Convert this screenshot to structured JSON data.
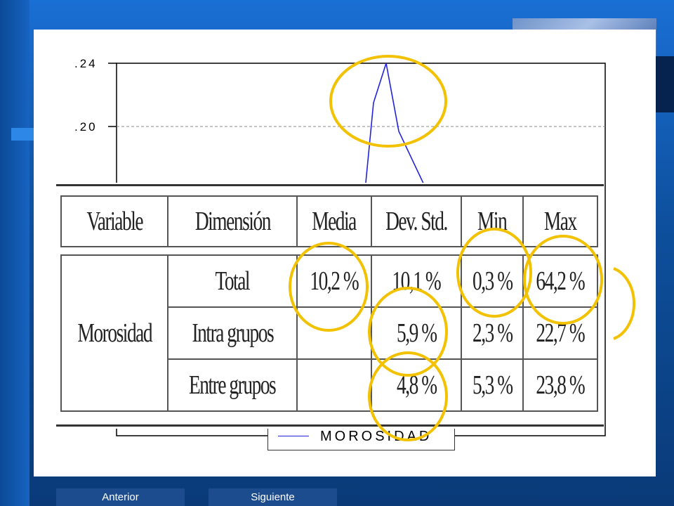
{
  "chart": {
    "y_ticks": [
      ".24",
      ".20"
    ],
    "legend_label": "MOROSIDAD"
  },
  "chart_data": {
    "type": "line",
    "series": [
      {
        "name": "MOROSIDAD",
        "values": [
          0.16,
          0.215,
          0.24,
          0.197,
          0.15
        ]
      }
    ],
    "ylim": [
      0.14,
      0.24
    ],
    "yticks": [
      0.2,
      0.24
    ]
  },
  "table": {
    "headers": [
      "Variable",
      "Dimensión",
      "Media",
      "Dev. Std.",
      "Min",
      "Max"
    ],
    "group_label": "Morosidad",
    "rows": [
      {
        "dimension": "Total",
        "media": "10,2 %",
        "dev": "10,1 %",
        "min": "0,3 %",
        "max": "64,2 %"
      },
      {
        "dimension": "Intra grupos",
        "media": "",
        "dev": "5,9 %",
        "min": "2,3 %",
        "max": "22,7 %"
      },
      {
        "dimension": "Entre grupos",
        "media": "",
        "dev": "4,8 %",
        "min": "5,3 %",
        "max": "23,8 %"
      }
    ]
  },
  "nav": {
    "prev": "Anterior",
    "next": "Siguiente"
  },
  "colors": {
    "accent_circle": "#f2c200",
    "line": "#2222dd",
    "background": "#1a6fd4"
  }
}
